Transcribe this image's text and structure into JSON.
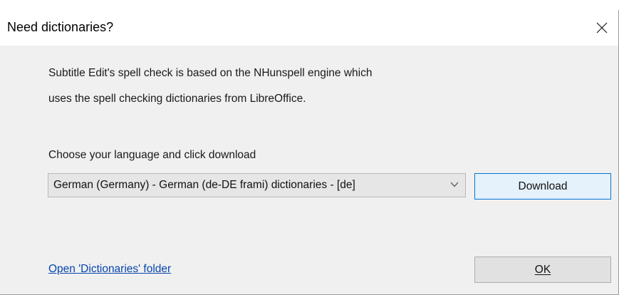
{
  "dialog": {
    "title": "Need dictionaries?",
    "close_icon": "close-icon",
    "intro_line_1": "Subtitle Edit's spell check is based on the NHunspell engine which",
    "intro_line_2": "uses the spell checking dictionaries from LibreOffice.",
    "choose_label": "Choose your language and click download",
    "language_select": {
      "selected": "German (Germany) - German (de-DE frami) dictionaries - [de]",
      "icon": "chevron-down-icon"
    },
    "download_label": "Download",
    "open_folder_link": "Open 'Dictionaries' folder",
    "ok_label": "OK",
    "colors": {
      "link": "#0645ad",
      "focus_border": "#0078d7",
      "dialog_bg": "#f0f0f0"
    }
  }
}
